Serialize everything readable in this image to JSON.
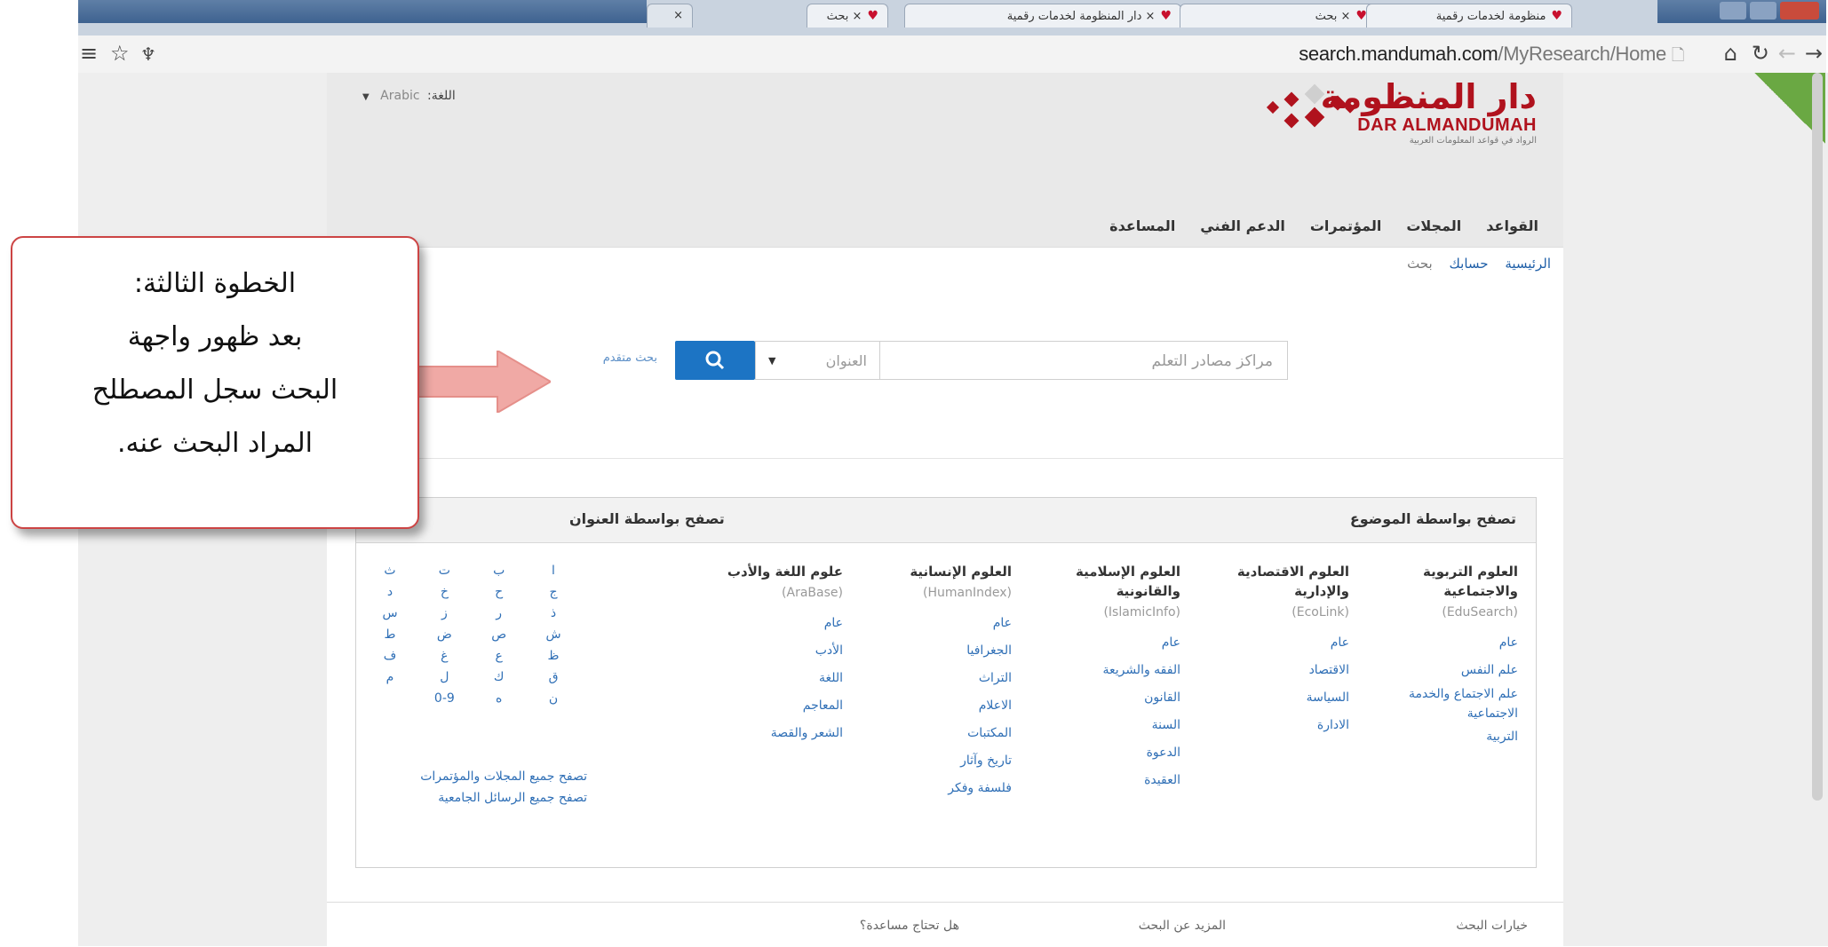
{
  "browser": {
    "tabs": [
      {
        "label": "× بحث"
      },
      {
        "label": "× دار المنظومة لخدمات رقمية"
      },
      {
        "label": "× بحث"
      },
      {
        "label": "منظومة لخدمات رقمية"
      }
    ],
    "url_host": "search.mandumah.com",
    "url_path": "/MyResearch/Home"
  },
  "header": {
    "language_label": "اللغة:",
    "language_value": "Arabic",
    "logo_arabic": "دار المنظومة",
    "logo_english": "DAR ALMANDUMAH",
    "logo_tagline": "الرواد في قواعد المعلومات العربية",
    "brand_color": "#b0121d"
  },
  "nav": {
    "items": [
      "القواعد",
      "المجلات",
      "المؤتمرات",
      "الدعم الفني",
      "المساعدة"
    ]
  },
  "breadcrumb": {
    "items": [
      "الرئيسية",
      "حسابك",
      "بحث"
    ]
  },
  "search": {
    "query_value": "مراكز مصادر التعلم",
    "type_value": "العنوان",
    "advanced_label": "بحث متقدم"
  },
  "browse": {
    "subject_heading": "تصفح بواسطة الموضوع",
    "title_heading": "تصفح بواسطة العنوان",
    "columns": [
      {
        "heading": "العلوم التربوية والاجتماعية",
        "db": "(EduSearch)",
        "links": [
          "عام",
          "علم النفس",
          "علم الاجتماع والخدمة الاجتماعية",
          "التربية"
        ]
      },
      {
        "heading": "العلوم الاقتصادية والإدارية",
        "db": "(EcoLink)",
        "links": [
          "عام",
          "الاقتصاد",
          "السياسة",
          "الادارة"
        ]
      },
      {
        "heading": "العلوم الإسلامية والقانونية",
        "db": "(IslamicInfo)",
        "links": [
          "عام",
          "الفقه والشريعة",
          "القانون",
          "السنة",
          "الدعوة",
          "العقيدة"
        ]
      },
      {
        "heading": "العلوم الإنسانية",
        "db": "(HumanIndex)",
        "links": [
          "عام",
          "الجغرافيا",
          "التراث",
          "الاعلام",
          "المكتبات",
          "تاريخ وآثار",
          "فلسفة وفكر"
        ]
      },
      {
        "heading": "علوم اللغة والأدب",
        "db": "(AraBase)",
        "links": [
          "عام",
          "الأدب",
          "اللغة",
          "المعاجم",
          "الشعر والقصة"
        ]
      }
    ],
    "alphabet_rows": [
      [
        "ا",
        "ب",
        "ت",
        "ث"
      ],
      [
        "ج",
        "ح",
        "خ",
        "د"
      ],
      [
        "ذ",
        "ر",
        "ز",
        "س"
      ],
      [
        "ش",
        "ص",
        "ض",
        "ط"
      ],
      [
        "ظ",
        "ع",
        "غ",
        "ف"
      ],
      [
        "ق",
        "ك",
        "ل",
        "م"
      ],
      [
        "ن",
        "ه",
        "0-9",
        ""
      ]
    ],
    "all_links": [
      "تصفح جميع المجلات والمؤتمرات",
      "تصفح جميع الرسائل الجامعية"
    ]
  },
  "footer": {
    "items": [
      "خيارات البحث",
      "المزيد عن البحث",
      "هل تحتاج مساعدة؟"
    ]
  },
  "callout": {
    "lines": [
      "الخطوة الثالثة:",
      "بعد ظهور واجهة",
      "البحث سجل المصطلح",
      "المراد البحث عنه."
    ]
  }
}
